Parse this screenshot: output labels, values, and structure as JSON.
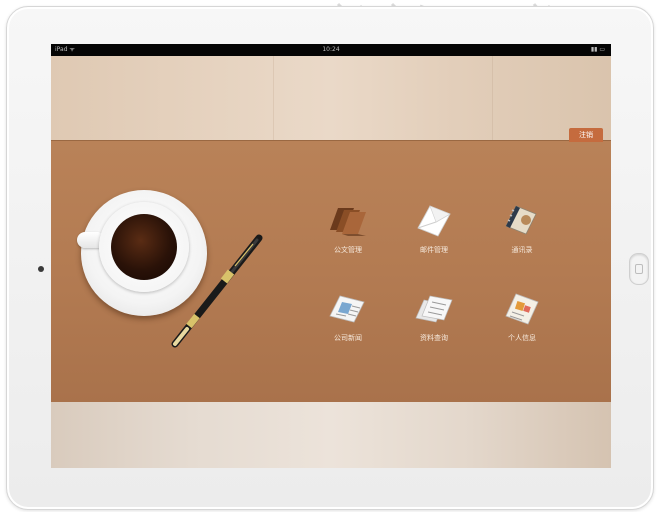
{
  "status_bar": {
    "carrier": "iPad ᯤ",
    "time": "10:24",
    "battery": "▮▮ ▭"
  },
  "top_tag": {
    "label": "注销"
  },
  "apps": [
    {
      "label": "公文管理",
      "icon": "folders-icon"
    },
    {
      "label": "邮件管理",
      "icon": "mail-envelope-icon"
    },
    {
      "label": "通讯录",
      "icon": "address-book-icon"
    },
    {
      "label": "公司新闻",
      "icon": "newspaper-icon"
    },
    {
      "label": "资料查询",
      "icon": "documents-icon"
    },
    {
      "label": "个人信息",
      "icon": "personal-info-icon"
    }
  ],
  "colors": {
    "main_panel": "#b37b52",
    "tag": "#c56b3e",
    "label_text": "#f6e9dc"
  }
}
